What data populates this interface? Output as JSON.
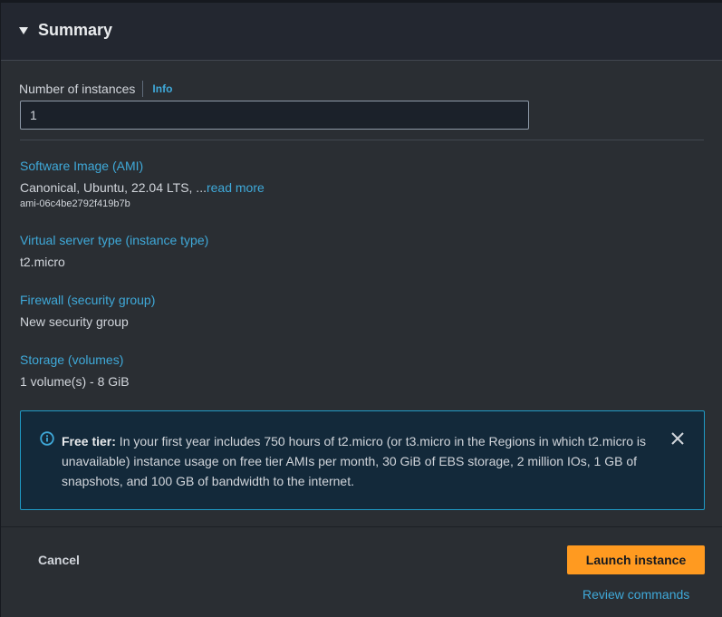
{
  "summary": {
    "title": "Summary",
    "number_of_instances": {
      "label": "Number of instances",
      "info_label": "Info",
      "value": "1"
    },
    "fields": [
      {
        "label": "Software Image (AMI)",
        "value": "Canonical, Ubuntu, 22.04 LTS, ...",
        "link": "read more",
        "sub": "ami-06c4be2792f419b7b"
      },
      {
        "label": "Virtual server type (instance type)",
        "value": "t2.micro"
      },
      {
        "label": "Firewall (security group)",
        "value": "New security group"
      },
      {
        "label": "Storage (volumes)",
        "value": "1 volume(s) - 8 GiB"
      }
    ],
    "alert": {
      "icon": "info-circle-icon",
      "title": "Free tier:",
      "text": " In your first year includes 750 hours of t2.micro (or t3.micro in the Regions in which t2.micro is unavailable) instance usage on free tier AMIs per month, 30 GiB of EBS storage, 2 million IOs, 1 GB of snapshots, and 100 GB of bandwidth to the internet.",
      "close_icon": "close-icon"
    }
  },
  "footer": {
    "cancel_label": "Cancel",
    "launch_label": "Launch instance",
    "review_label": "Review commands"
  },
  "colors": {
    "accent_link": "#3fa9d9",
    "primary_button": "#ff9a20",
    "alert_border": "#1f9ac5",
    "alert_bg": "#13293a"
  }
}
